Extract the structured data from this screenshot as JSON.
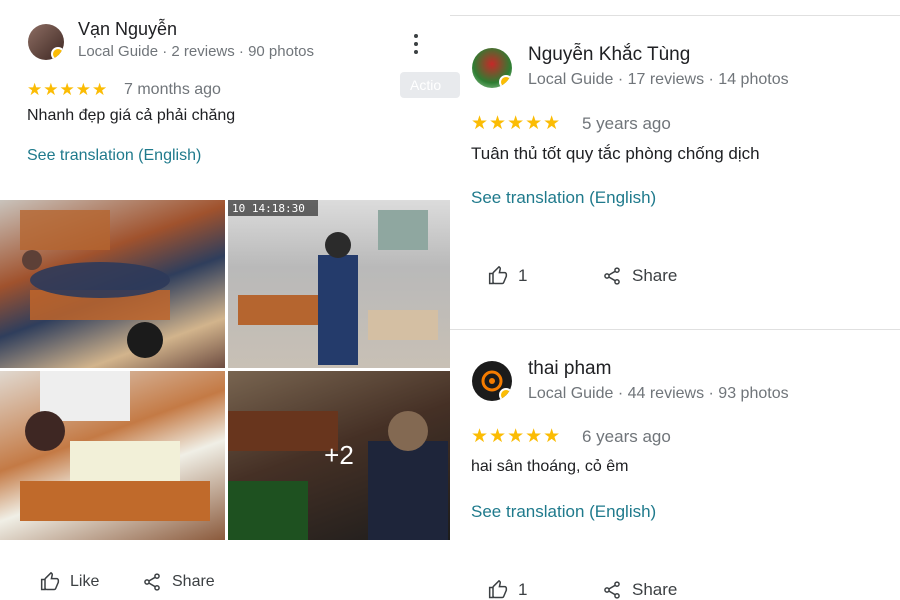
{
  "reviews": [
    {
      "name": "Vạn Nguyễn",
      "meta": "Local Guide · 2 reviews · 90 photos",
      "stars": "★★★★★",
      "ago": "7 months ago",
      "text": "Nhanh đẹp giá cả phải chăng",
      "translate": "See translation (English)",
      "photos_more": "+2",
      "like_label": "Like",
      "share_label": "Share",
      "camera_timestamp": "10 14:18:30"
    },
    {
      "name": "Nguyễn Khắc Tùng",
      "meta": "Local Guide · 17 reviews · 14 photos",
      "stars": "★★★★★",
      "ago": "5 years ago",
      "text": "Tuân thủ tốt quy tắc phòng chống dịch",
      "translate": "See translation (English)",
      "likes": "1",
      "share_label": "Share"
    },
    {
      "name": "thai pham",
      "meta": "Local Guide · 44 reviews · 93 photos",
      "stars": "★★★★★",
      "ago": "6 years ago",
      "text": "hai sân thoáng, cỏ êm",
      "translate": "See translation (English)",
      "likes": "1",
      "share_label": "Share"
    }
  ],
  "actions_chip": "Actio",
  "colors": {
    "star": "#fbbc04",
    "link": "#1f7a8c",
    "meta": "#70757a"
  }
}
